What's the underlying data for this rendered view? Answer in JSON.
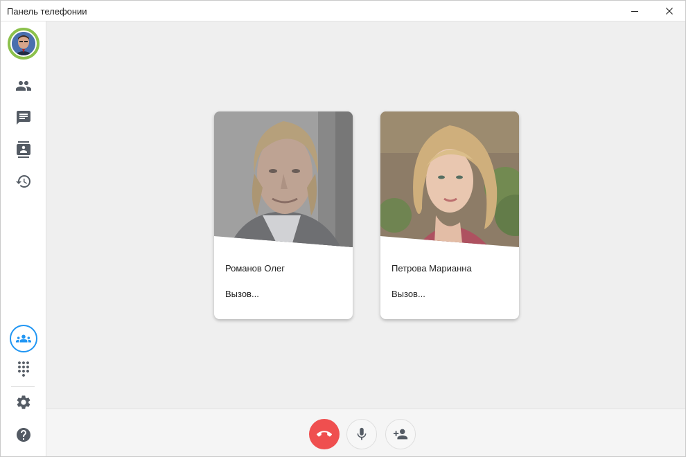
{
  "window": {
    "title": "Панель телефонии",
    "controls": [
      "minimize-icon",
      "close-icon"
    ]
  },
  "sidebar": {
    "avatar_status_color": "#8cc14c",
    "items": [
      {
        "icon": "people-icon"
      },
      {
        "icon": "chat-icon"
      },
      {
        "icon": "contacts-book-icon"
      },
      {
        "icon": "history-icon"
      }
    ],
    "bottom_items": [
      {
        "icon": "conference-icon",
        "active": true
      },
      {
        "icon": "dialpad-icon"
      },
      {
        "icon": "gear-icon"
      },
      {
        "icon": "help-icon"
      }
    ]
  },
  "participants": [
    {
      "name": "Романов Олег",
      "status": "Вызов..."
    },
    {
      "name": "Петрова Марианна",
      "status": "Вызов..."
    }
  ],
  "call_controls": {
    "hangup_color": "#ef4f4f",
    "items": [
      "hangup-icon",
      "mic-icon",
      "add-person-icon"
    ]
  },
  "colors": {
    "accent": "#2196f3",
    "status_online": "#8cc14c",
    "hangup": "#ef4f4f"
  }
}
